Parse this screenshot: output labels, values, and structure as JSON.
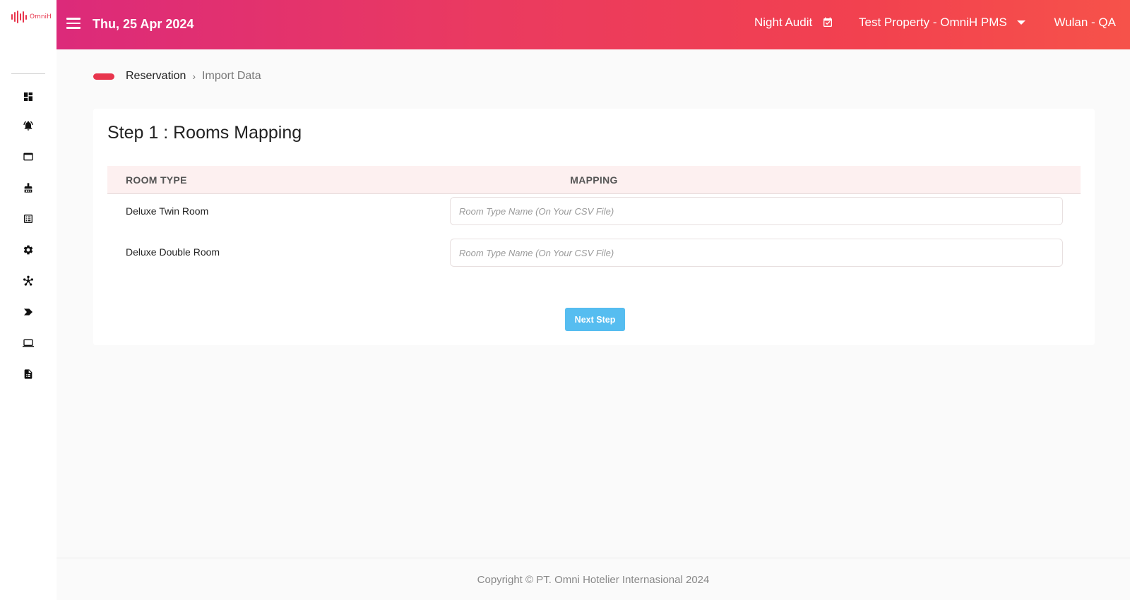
{
  "app": {
    "logo_text": "OmniH",
    "brand_color": "#e8354d"
  },
  "sidebar": {
    "items": [
      {
        "icon": "dashboard-icon"
      },
      {
        "icon": "bell-icon"
      },
      {
        "icon": "window-icon"
      },
      {
        "icon": "broom-icon"
      },
      {
        "icon": "list-icon"
      },
      {
        "icon": "gear-icon"
      },
      {
        "icon": "network-icon"
      },
      {
        "icon": "tag-icon"
      },
      {
        "icon": "laptop-icon"
      },
      {
        "icon": "report-icon"
      }
    ]
  },
  "header": {
    "date": "Thu, 25 Apr 2024",
    "night_audit_label": "Night Audit",
    "property_label": "Test Property - OmniH PMS",
    "user_label": "Wulan - QA"
  },
  "breadcrumb": {
    "first": "Reservation",
    "separator": "›",
    "current": "Import Data"
  },
  "card": {
    "title": "Step 1 : Rooms Mapping",
    "columns": {
      "room_type": "ROOM TYPE",
      "mapping": "MAPPING"
    },
    "rows": [
      {
        "room_type": "Deluxe Twin Room",
        "placeholder": "Room Type Name (On Your CSV File)",
        "value": ""
      },
      {
        "room_type": "Deluxe Double Room",
        "placeholder": "Room Type Name (On Your CSV File)",
        "value": ""
      }
    ],
    "next_button": "Next Step"
  },
  "footer": {
    "copyright": "Copyright © PT. Omni Hotelier Internasional 2024"
  }
}
